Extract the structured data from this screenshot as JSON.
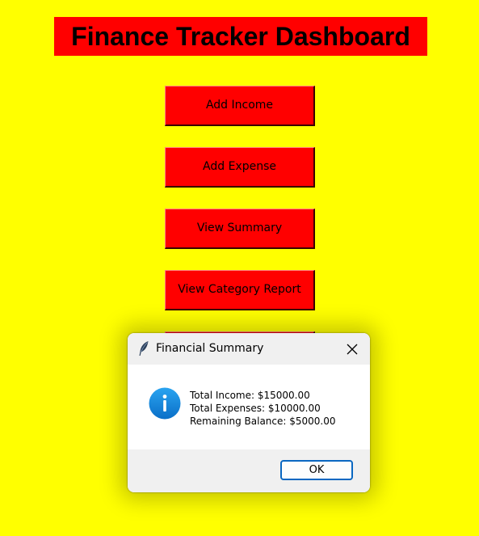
{
  "app": {
    "title": "Finance Tracker Dashboard",
    "background_color": "#ffff00",
    "accent_color": "#ff0000"
  },
  "menu": {
    "buttons": [
      {
        "label": "Add Income"
      },
      {
        "label": "Add Expense"
      },
      {
        "label": "View Summary"
      },
      {
        "label": "View Category Report"
      }
    ]
  },
  "dialog": {
    "title": "Financial Summary",
    "window_icon": "feather-icon",
    "message_icon": "info-icon",
    "lines": [
      "Total Income: $15000.00",
      "Total Expenses: $10000.00",
      "Remaining Balance: $5000.00"
    ],
    "ok_label": "OK",
    "close_icon": "close-icon"
  }
}
